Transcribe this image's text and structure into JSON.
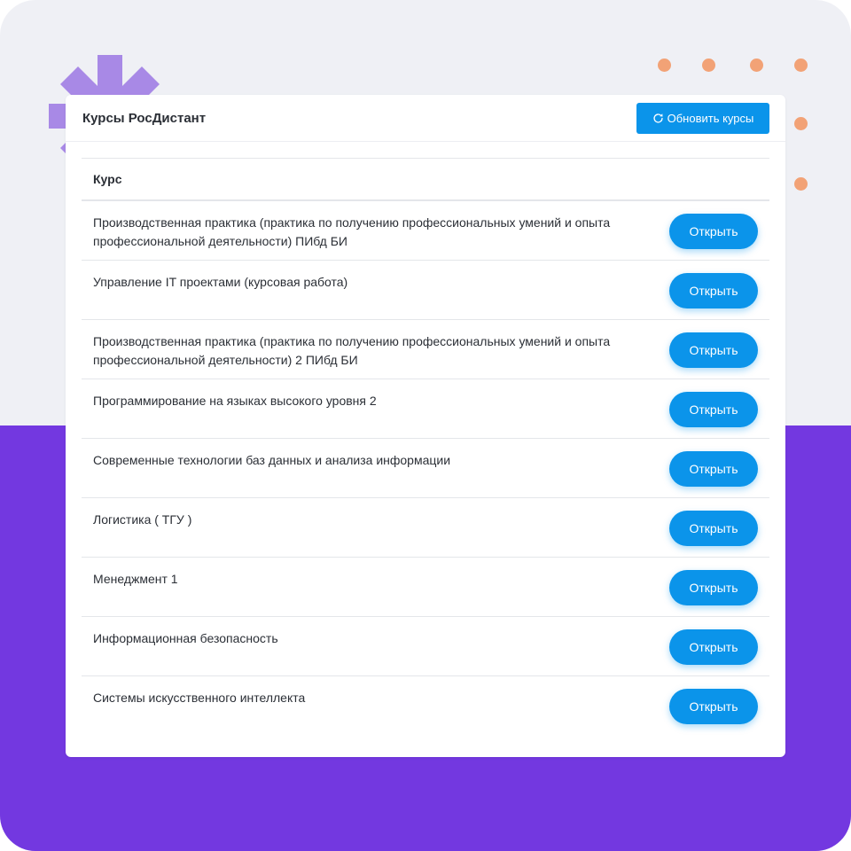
{
  "colors": {
    "background_top": "#eff0f5",
    "background_bottom": "#7338e0",
    "accent_blue": "#0b94ea",
    "decor_star": "#a889e6",
    "decor_dots": "#f2a276"
  },
  "icons": {
    "refresh": "refresh-icon"
  },
  "card": {
    "title": "Курсы РосДистант",
    "refresh_label": "Обновить курсы"
  },
  "table": {
    "column_header": "Курс",
    "open_label": "Открыть",
    "rows": [
      {
        "name": "Производственная практика (практика по получению профессиональных умений и опыта профессиональной деятельности) ПИбд БИ"
      },
      {
        "name": "Управление IT проектами (курсовая работа)"
      },
      {
        "name": "Производственная практика (практика по получению профессиональных умений и опыта профессиональной деятельности) 2 ПИбд БИ"
      },
      {
        "name": "Программирование на языках высокого уровня 2"
      },
      {
        "name": "Современные технологии баз данных и анализа информации"
      },
      {
        "name": "Логистика ( ТГУ )"
      },
      {
        "name": "Менеджмент 1"
      },
      {
        "name": "Информационная безопасность"
      },
      {
        "name": "Системы искусственного интеллекта"
      }
    ]
  }
}
